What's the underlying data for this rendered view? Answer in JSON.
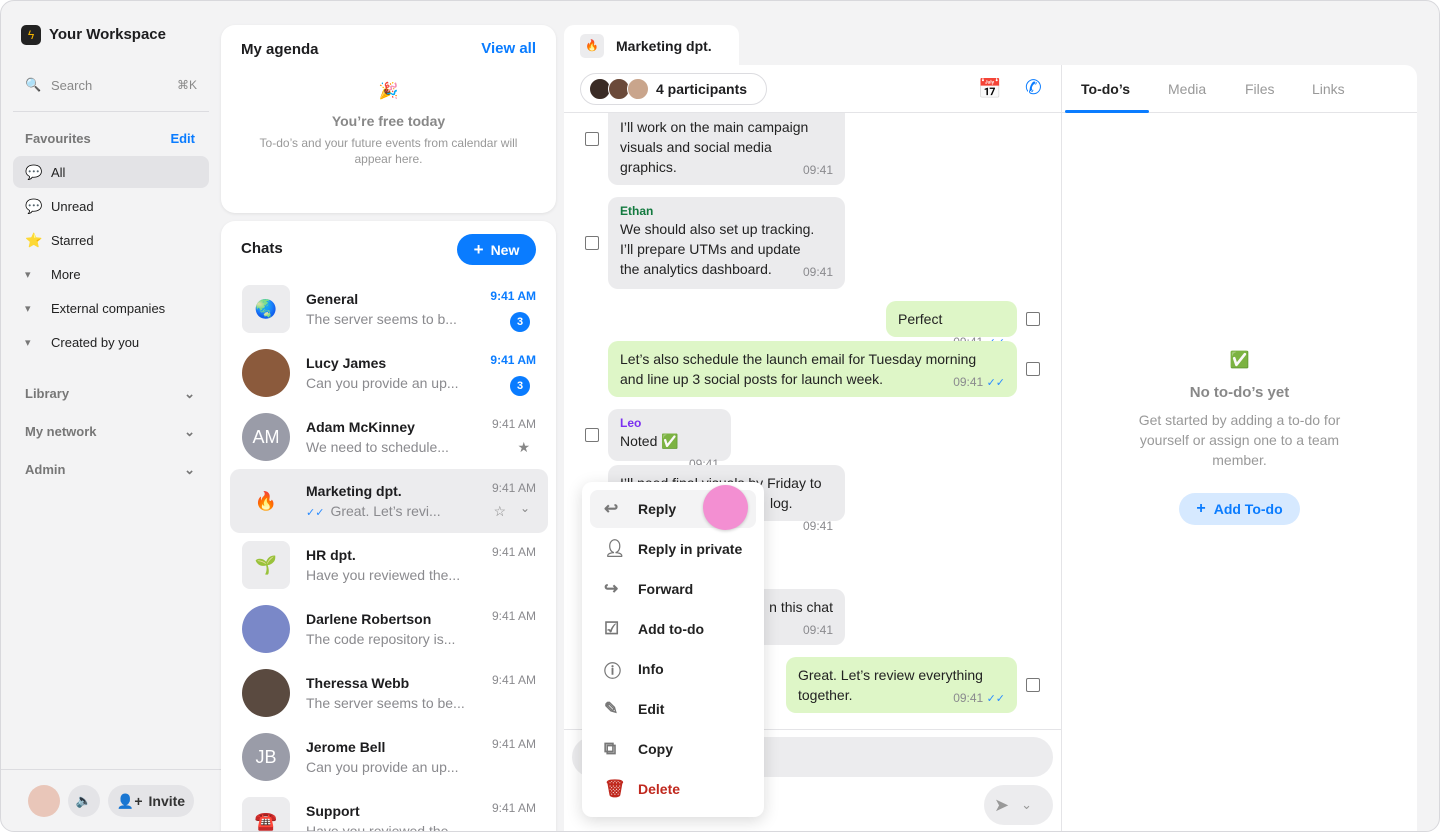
{
  "workspace": {
    "name": "Your Workspace",
    "logo_icon": "bolt-icon"
  },
  "sidebar": {
    "search_label": "Search",
    "search_shortcut": "⌘K",
    "favourites_label": "Favourites",
    "edit_label": "Edit",
    "items": [
      {
        "label": "All",
        "icon": "💬"
      },
      {
        "label": "Unread",
        "icon": "💬"
      },
      {
        "label": "Starred",
        "icon": "⭐"
      },
      {
        "label": "More",
        "icon": "▾"
      },
      {
        "label": "External companies",
        "icon": "▾"
      },
      {
        "label": "Created by you",
        "icon": "▾"
      }
    ],
    "sections": [
      "Library",
      "My network",
      "Admin"
    ],
    "invite_label": "Invite"
  },
  "agenda": {
    "title": "My agenda",
    "view_all": "View all",
    "emoji": "🎉",
    "empty_title": "You’re free today",
    "empty_text": "To-do’s and your future events from calendar will appear here."
  },
  "chats": {
    "title": "Chats",
    "new_label": "New",
    "list": [
      {
        "name": "General",
        "preview": "The server seems to b...",
        "time": "9:41 AM",
        "unread": "3",
        "avatar": "🌏"
      },
      {
        "name": "Lucy James",
        "preview": "Can you provide an up...",
        "time": "9:41 AM",
        "unread": "3",
        "avatar": ""
      },
      {
        "name": "Adam McKinney",
        "preview": "We need to schedule...",
        "time": "9:41 AM",
        "avatar": "AM"
      },
      {
        "name": "Marketing dpt.",
        "preview": "Great. Let’s revi...",
        "time": "9:41 AM",
        "avatar": "🔥"
      },
      {
        "name": "HR dpt.",
        "preview": "Have you reviewed the...",
        "time": "9:41 AM",
        "avatar": "🌱"
      },
      {
        "name": "Darlene Robertson",
        "preview": "The code repository is...",
        "time": "9:41 AM",
        "avatar": ""
      },
      {
        "name": "Theressa Webb",
        "preview": "The server seems to be...",
        "time": "9:41 AM",
        "avatar": ""
      },
      {
        "name": "Jerome Bell",
        "preview": "Can you provide an up...",
        "time": "9:41 AM",
        "avatar": "JB"
      },
      {
        "name": "Support",
        "preview": "Have you reviewed the...",
        "time": "9:41 AM",
        "avatar": "☎️"
      }
    ]
  },
  "conversation": {
    "tab_title": "Marketing dpt.",
    "tab_emoji": "🔥",
    "participants": "4 participants",
    "messages": [
      {
        "text1": "I’ll work on the main campaign",
        "text2": "visuals and social media",
        "text3": "graphics.",
        "time": "09:41"
      },
      {
        "sender": "Ethan",
        "text1": "We should also set up tracking.",
        "text2": "I’ll prepare UTMs and update",
        "text3": "the analytics dashboard.",
        "time": "09:41"
      },
      {
        "text1": "Perfect",
        "time": "09:41"
      },
      {
        "text1": "Let’s also schedule the launch email for Tuesday morning",
        "text2": "and line up 3 social posts for launch week.",
        "time": "09:41"
      },
      {
        "sender": "Leo",
        "text1": "Noted ✅",
        "time": "09:41"
      },
      {
        "text1": "I’ll need final visuals by Friday to",
        "text2": "log.",
        "time": "09:41"
      },
      {
        "text1": "n this chat",
        "time": "09:41"
      },
      {
        "text1": "Great. Let’s review everything",
        "text2": "together.",
        "time": "09:41"
      }
    ]
  },
  "context_menu": [
    "Reply",
    "Reply in private",
    "Forward",
    "Add to-do",
    "Info",
    "Edit",
    "Copy",
    "Delete"
  ],
  "right_panel": {
    "tabs": [
      "To-do’s",
      "Media",
      "Files",
      "Links"
    ],
    "emoji": "✅",
    "empty_title": "No to-do’s yet",
    "empty_text": "Get started by adding a to-do for yourself or assign one to a team member.",
    "add_label": "Add To-do"
  }
}
